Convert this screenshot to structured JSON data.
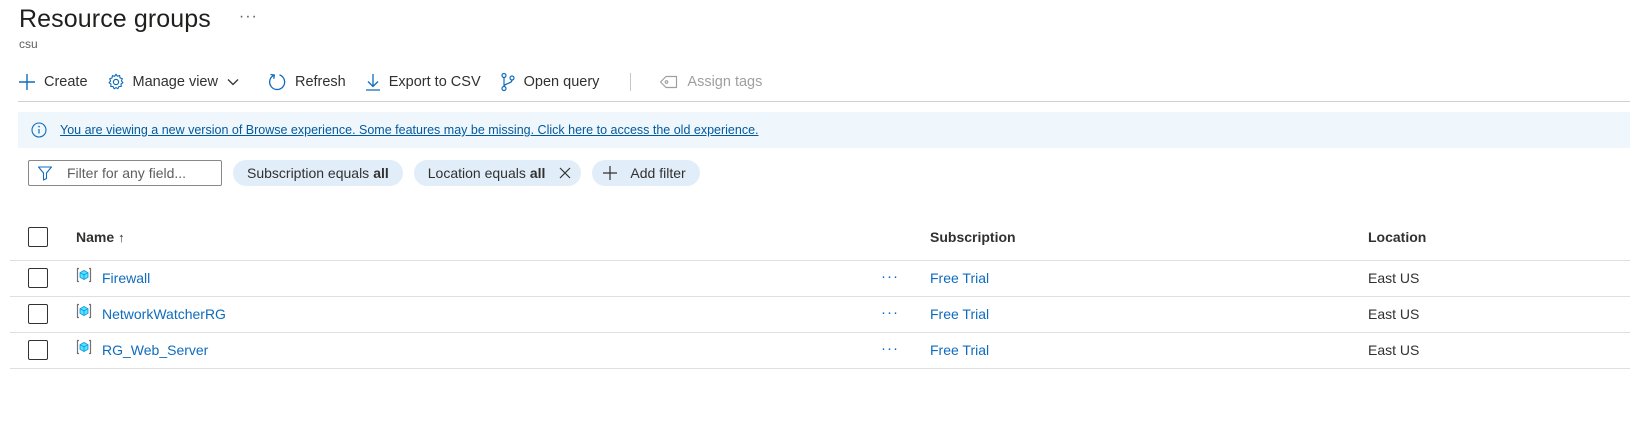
{
  "header": {
    "title": "Resource groups",
    "more": "···",
    "subtitle": "csu"
  },
  "toolbar": {
    "create": "Create",
    "manage_view": "Manage view",
    "refresh": "Refresh",
    "export": "Export to CSV",
    "open_query": "Open query",
    "assign_tags": "Assign tags"
  },
  "banner": {
    "text": "You are viewing a new version of Browse experience. Some features may be missing. Click here to access the old experience."
  },
  "filters": {
    "search_placeholder": "Filter for any field...",
    "pills": [
      {
        "label": "Subscription equals",
        "value": "all"
      },
      {
        "label": "Location equals",
        "value": "all"
      }
    ],
    "add_filter": "Add filter"
  },
  "table": {
    "columns": {
      "name": "Name",
      "sort_indicator": "↑",
      "subscription": "Subscription",
      "location": "Location"
    },
    "rows": [
      {
        "name": "Firewall",
        "subscription": "Free Trial",
        "location": "East US",
        "more": "···"
      },
      {
        "name": "NetworkWatcherRG",
        "subscription": "Free Trial",
        "location": "East US",
        "more": "···"
      },
      {
        "name": "RG_Web_Server",
        "subscription": "Free Trial",
        "location": "East US",
        "more": "···"
      }
    ]
  },
  "colors": {
    "accent": "#0f6cbd",
    "banner_bg": "#eff6fc",
    "pill_bg": "#e1eefa",
    "link": "#005a9e"
  },
  "icons": [
    "plus-icon",
    "gear-icon",
    "chevron-down-icon",
    "refresh-icon",
    "download-icon",
    "query-icon",
    "tag-icon",
    "info-icon",
    "filter-icon",
    "close-icon",
    "resource-group-icon"
  ]
}
